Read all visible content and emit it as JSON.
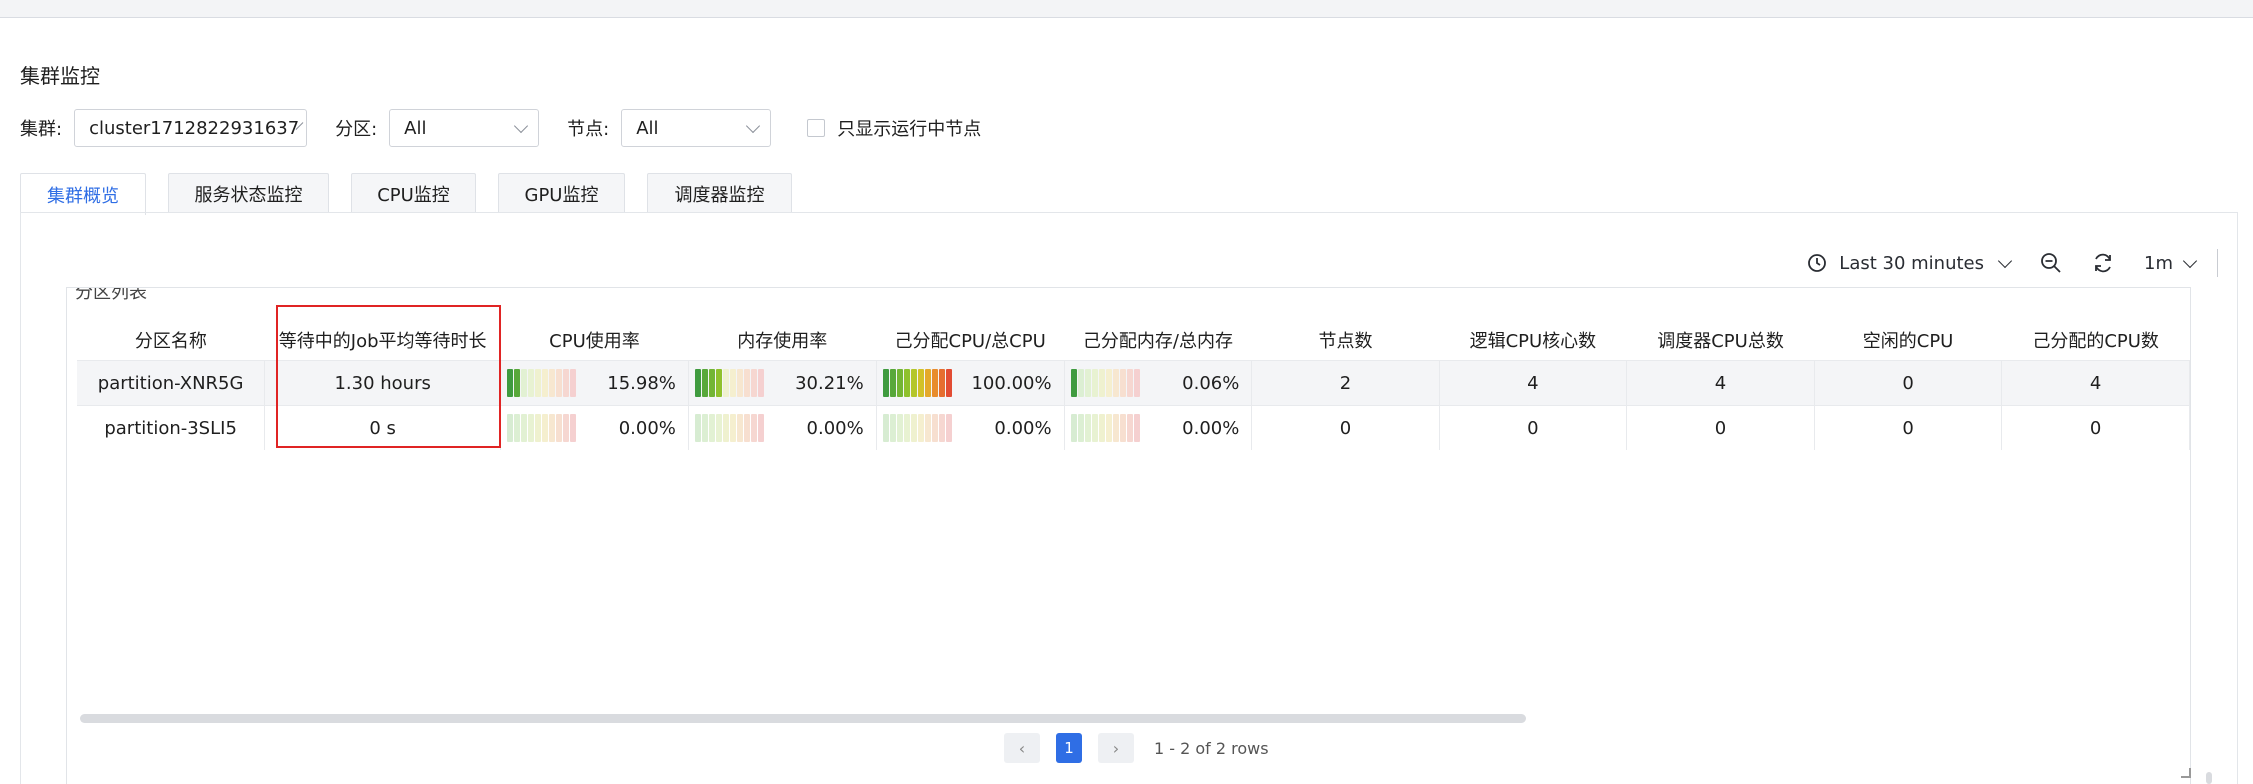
{
  "page_title": "集群监控",
  "filters": {
    "cluster_label": "集群:",
    "cluster_value": "cluster1712822931637",
    "partition_label": "分区:",
    "partition_value": "All",
    "node_label": "节点:",
    "node_value": "All",
    "running_only_label": "只显示运行中节点"
  },
  "tabs": [
    {
      "label": "集群概览",
      "active": true
    },
    {
      "label": "服务状态监控",
      "active": false
    },
    {
      "label": "CPU监控",
      "active": false
    },
    {
      "label": "GPU监控",
      "active": false
    },
    {
      "label": "调度器监控",
      "active": false
    }
  ],
  "toolbar": {
    "time_range": "Last 30 minutes",
    "refresh_interval": "1m",
    "icons": [
      "clock-icon",
      "zoom-out-icon",
      "refresh-icon",
      "chevron-down-icon"
    ]
  },
  "section_title": "分区列表",
  "table": {
    "columns": [
      "分区名称",
      "等待中的Job平均等待时长",
      "CPU使用率",
      "内存使用率",
      "己分配CPU/总CPU",
      "己分配内存/总内存",
      "节点数",
      "逻辑CPU核心数",
      "调度器CPU总数",
      "空闲的CPU",
      "己分配的CPU数"
    ],
    "rows": [
      {
        "name": "partition-XNR5G",
        "wait": "1.30 hours",
        "cpu_pct": "15.98%",
        "cpu_frac": 0.1598,
        "mem_pct": "30.21%",
        "mem_frac": 0.3021,
        "alloc_cpu_pct": "100.00%",
        "alloc_cpu_frac": 1.0,
        "alloc_mem_pct": "0.06%",
        "alloc_mem_frac": 0.0006,
        "nodes": "2",
        "logical_cores": "4",
        "sched_cpus": "4",
        "idle_cpus": "0",
        "alloc_cpus": "4"
      },
      {
        "name": "partition-3SLI5",
        "wait": "0 s",
        "cpu_pct": "0.00%",
        "cpu_frac": 0,
        "mem_pct": "0.00%",
        "mem_frac": 0,
        "alloc_cpu_pct": "0.00%",
        "alloc_cpu_frac": 0,
        "alloc_mem_pct": "0.00%",
        "alloc_mem_frac": 0,
        "nodes": "0",
        "logical_cores": "0",
        "sched_cpus": "0",
        "idle_cpus": "0",
        "alloc_cpus": "0"
      }
    ]
  },
  "pagination": {
    "prev": "‹",
    "next": "›",
    "current_page": "1",
    "summary": "1 - 2 of 2 rows"
  },
  "colors": {
    "accent": "#2f6ee5",
    "highlight_border": "#e02424",
    "gauge_on": [
      "#3f9b3f",
      "#58a83a",
      "#73b534",
      "#8fc12d",
      "#b4c62a",
      "#d2c128",
      "#e4a92a",
      "#e88c2c",
      "#e66d2f",
      "#e24c33"
    ],
    "gauge_off": [
      "#d7ecd2",
      "#dcefd3",
      "#e2f1d3",
      "#e8f2d2",
      "#eff1cf",
      "#f5efcf",
      "#f7e7d0",
      "#f7dfd0",
      "#f6d7d1",
      "#f5d0d0"
    ]
  }
}
